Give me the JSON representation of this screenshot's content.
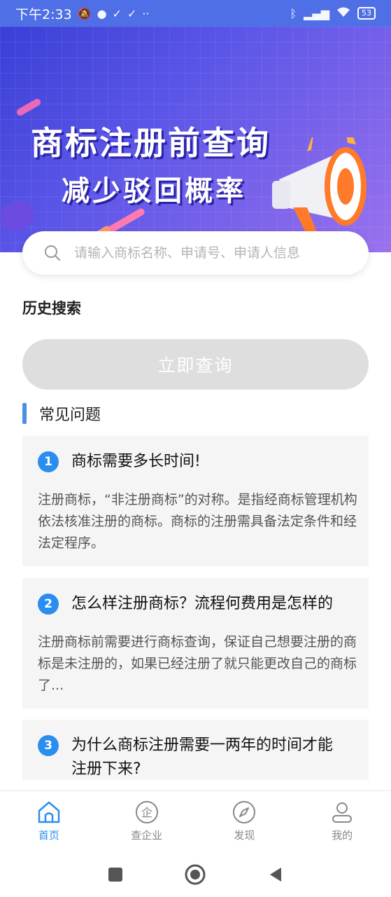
{
  "status_bar": {
    "time": "下午2:33",
    "battery": "53"
  },
  "banner": {
    "title": "商标注册前查询",
    "subtitle": "减少驳回概率"
  },
  "search": {
    "placeholder": "请输入商标名称、申请号、申请人信息"
  },
  "history": {
    "title": "历史搜索"
  },
  "query_button": "立即查询",
  "faq": {
    "title": "常见问题",
    "items": [
      {
        "num": "1",
        "question": "商标需要多长时间!",
        "answer": "注册商标，“非注册商标”的对称。是指经商标管理机构依法核准注册的商标。商标的注册需具备法定条件和经法定程序。"
      },
      {
        "num": "2",
        "question": "怎么样注册商标？流程何费用是怎样的",
        "answer": "注册商标前需要进行商标查询，保证自己想要注册的商标是未注册的，如果已经注册了就只能更改自己的商标了..."
      },
      {
        "num": "3",
        "question": "为什么商标注册需要一两年的时间才能注册下来?",
        "answer": ""
      }
    ]
  },
  "bottom_nav": [
    {
      "label": "首页",
      "icon": "home-icon",
      "active": true
    },
    {
      "label": "查企业",
      "icon": "enterprise-icon",
      "active": false
    },
    {
      "label": "发现",
      "icon": "compass-icon",
      "active": false
    },
    {
      "label": "我的",
      "icon": "user-icon",
      "active": false
    }
  ],
  "colors": {
    "accent": "#2a8ef0",
    "banner_start": "#3a3fd6",
    "banner_end": "#9a72ee",
    "disabled_button": "#dedede"
  }
}
